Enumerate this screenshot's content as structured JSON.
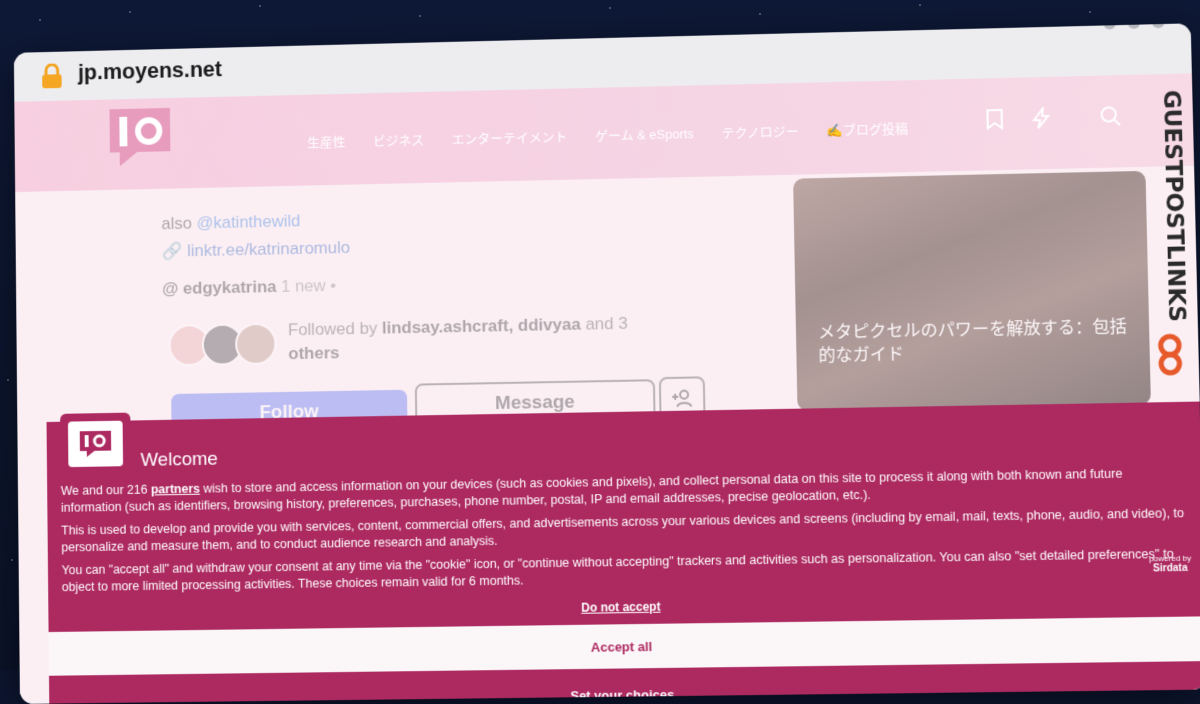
{
  "browser": {
    "url": "jp.moyens.net"
  },
  "header": {
    "logo_text": "IO",
    "nav": [
      "生産性",
      "ビジネス",
      "エンターテイメント",
      "ゲーム & eSports",
      "テクノロジー",
      "✍️ブログ投稿"
    ]
  },
  "brand_side": "GUESTPOSTLINKS",
  "profile": {
    "also_label": "also",
    "also_handle": "@katinthewild",
    "link": "linktr.ee/katrinaromulo",
    "threads_handle": "edgykatrina",
    "threads_new": "1 new •",
    "followed_prefix": "Followed by",
    "followed_names": "lindsay.ashcraft, ddivyaa",
    "followed_and": "and 3",
    "followed_others": "others",
    "follow_btn": "Follow",
    "message_btn": "Message"
  },
  "card": {
    "title": "メタピクセルのパワーを解放する：包括的なガイド"
  },
  "consent": {
    "logo_text": "IO",
    "title": "Welcome",
    "p1_before": "We and our 216",
    "p1_link": "partners",
    "p1_after": "wish to store and access information on your devices (such as cookies and pixels), and collect personal data on this site to process it along with both known and future information (such as identifiers, browsing history, preferences, purchases, phone number, postal, IP and email addresses, precise geolocation, etc.).",
    "p2": "This is used to develop and provide you with services, content, commercial offers, and advertisements across your various devices and screens (including by email, mail, texts, phone, audio, and video), to personalize and measure them, and to conduct audience research and analysis.",
    "p3": "You can \"accept all\" and withdraw your consent at any time via the \"cookie\" icon, or \"continue without accepting\" trackers and activities such as personalization. You can also \"set detailed preferences\" to object to more limited processing activities. These choices remain valid for 6 months.",
    "powered_by": "powered by",
    "powered_brand": "Sirdata",
    "do_not_accept": "Do not accept",
    "accept_all": "Accept all",
    "set_choices": "Set your choices"
  },
  "colors": {
    "accent": "#ad2a61",
    "header": "#f7cfe0",
    "follow": "#9aa6f6"
  }
}
